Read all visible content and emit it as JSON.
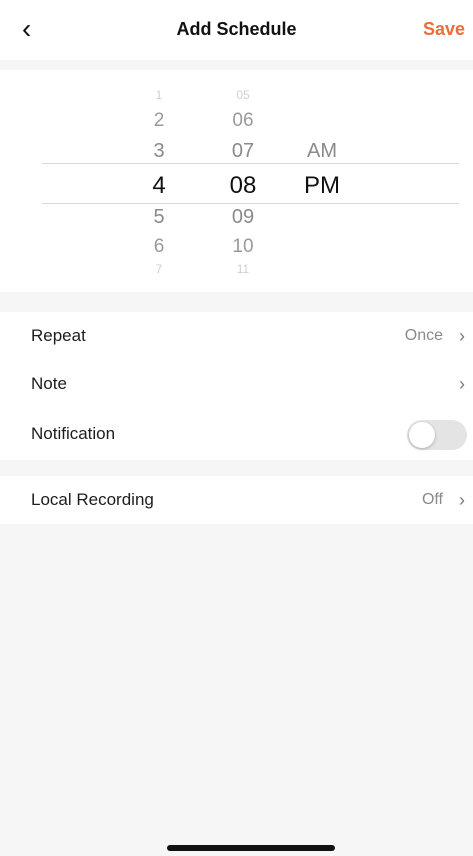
{
  "header": {
    "back_icon": "chevron-left-icon",
    "title": "Add Schedule",
    "save_label": "Save",
    "save_color": "#ee6b3b"
  },
  "time_picker": {
    "hours": [
      "1",
      "2",
      "3",
      "4",
      "5",
      "6",
      "7"
    ],
    "minutes": [
      "05",
      "06",
      "07",
      "08",
      "09",
      "10",
      "11"
    ],
    "periods": [
      "AM",
      "PM"
    ],
    "selected_hour": "4",
    "selected_minute": "08",
    "selected_period": "PM"
  },
  "settings": {
    "repeat": {
      "label": "Repeat",
      "value": "Once"
    },
    "note": {
      "label": "Note"
    },
    "notification": {
      "label": "Notification",
      "enabled": false
    },
    "local_recording": {
      "label": "Local Recording",
      "value": "Off"
    }
  }
}
